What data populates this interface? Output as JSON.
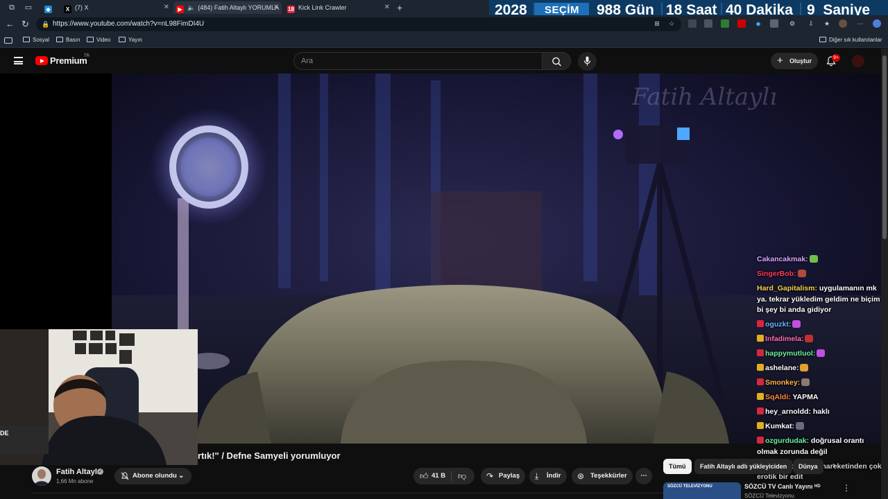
{
  "browser": {
    "tabs": [
      {
        "title": "",
        "active": false
      },
      {
        "title": "(7) X",
        "active": false
      },
      {
        "title": "(484) Fatih Altaylı YORUMLA",
        "active": true
      },
      {
        "title": "Kick Link Crawler",
        "active": false
      }
    ],
    "url": "https://www.youtube.com/watch?v=nL98FimDI4U",
    "bookmarks": [
      "Sosyal",
      "Basın",
      "Video",
      "Yayın"
    ],
    "other_bookmarks": "Diğer sık kullanılanlar"
  },
  "countdown": {
    "year": "2028",
    "label": "SEÇİM",
    "days": "988 Gün",
    "hours": "18 Saat",
    "minutes": "40 Dakika",
    "seconds": "9  Saniye"
  },
  "youtube": {
    "brand": "Premium",
    "region": "TR",
    "search_placeholder": "Ara",
    "create_label": "Oluştur",
    "notification_badge": "9+"
  },
  "video": {
    "watermark": "Fatih Altaylı",
    "title": "rtık!\" / Defne Samyeli yorumluyor",
    "channel": "Fatih Altaylı",
    "subscribers": "1,66 Mn abone",
    "subscribe_label": "Abone olundu",
    "likes": "41 B",
    "share_label": "Paylaş",
    "download_label": "İndir",
    "thanks_label": "Teşekkürler"
  },
  "chat": [
    {
      "user": "Cakancakmak:",
      "color": "#d6a6ff",
      "text": ""
    },
    {
      "user": "SingerBob:",
      "color": "#ff3b5c",
      "text": ""
    },
    {
      "user": "Hard_Gapitalism:",
      "color": "#f6d54a",
      "text": "uygulamanın mk ya. tekrar yükledim geldim ne biçim bi şey bi anda gidiyor"
    },
    {
      "user": "oguzkt:",
      "color": "#6ab7ff",
      "text": ""
    },
    {
      "user": "Infadimela:",
      "color": "#ff6fb5",
      "text": ""
    },
    {
      "user": "happymutluol:",
      "color": "#6cf0a0",
      "text": ""
    },
    {
      "user": "ashelane:",
      "color": "#ffffff",
      "text": ""
    },
    {
      "user": "Smonkey:",
      "color": "#ffb347",
      "text": ""
    },
    {
      "user": "SqAldi:",
      "color": "#ff8c3a",
      "text": "YAPMA"
    },
    {
      "user": "hey_arnoldd:",
      "color": "#ffffff",
      "text": "haklı"
    },
    {
      "user": "Kumkat:",
      "color": "#ffffff",
      "text": ""
    },
    {
      "user": "ozgurdudak:",
      "color": "#6cf0a0",
      "text": "doğrusal orantı olmak zorunda değil"
    },
    {
      "user": "",
      "color": "#ffffff",
      "text": "...bi az önceki fare hareketinden çok erotik bir edit"
    }
  ],
  "sidebar": {
    "chips": [
      "Tümü",
      "Fatih Altaylı adlı yükleyiciden",
      "Dünya"
    ],
    "suggestion_title": "SÖZCÜ TV Canlı Yayını",
    "suggestion_channel": "SÖZCÜ Televizyonu",
    "suggestion_caption": "SÖZCÜ TELEVİZYONU"
  },
  "colors": {
    "accent": "#ff0000",
    "background": "#0f0f0f",
    "countdown_bg": "#0d3a63",
    "countdown_label_bg": "#1e6fb8"
  }
}
